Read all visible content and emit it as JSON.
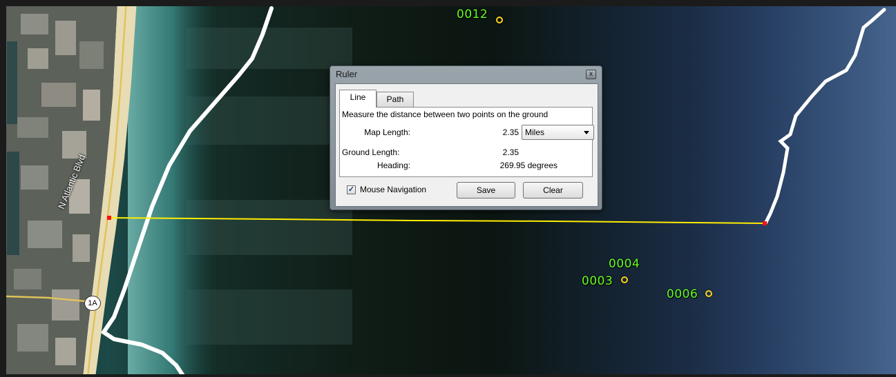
{
  "ruler": {
    "title": "Ruler",
    "close_glyph": "x",
    "tabs": [
      {
        "label": "Line",
        "active": true
      },
      {
        "label": "Path",
        "active": false
      }
    ],
    "description": "Measure the distance between two points on the ground",
    "map_length_label": "Map Length:",
    "map_length_value": "2.35",
    "unit_selected": "Miles",
    "ground_length_label": "Ground Length:",
    "ground_length_value": "2.35",
    "heading_label": "Heading:",
    "heading_value": "269.95 degrees",
    "mouse_navigation_label": "Mouse Navigation",
    "mouse_navigation_checked": true,
    "checkbox_glyph": "✓",
    "save_label": "Save",
    "clear_label": "Clear"
  },
  "map": {
    "road_label": "N Atlantic Blvd",
    "route_shield": "1A",
    "placemarks": [
      "0012",
      "0004",
      "0003",
      "0006"
    ],
    "measure_line_color": "#ffee00",
    "endpoint_color": "#ff1010",
    "boundary_color": "#ffffff",
    "placemark_label_color": "#66ff22",
    "placemark_icon_color": "#ffd21a"
  }
}
